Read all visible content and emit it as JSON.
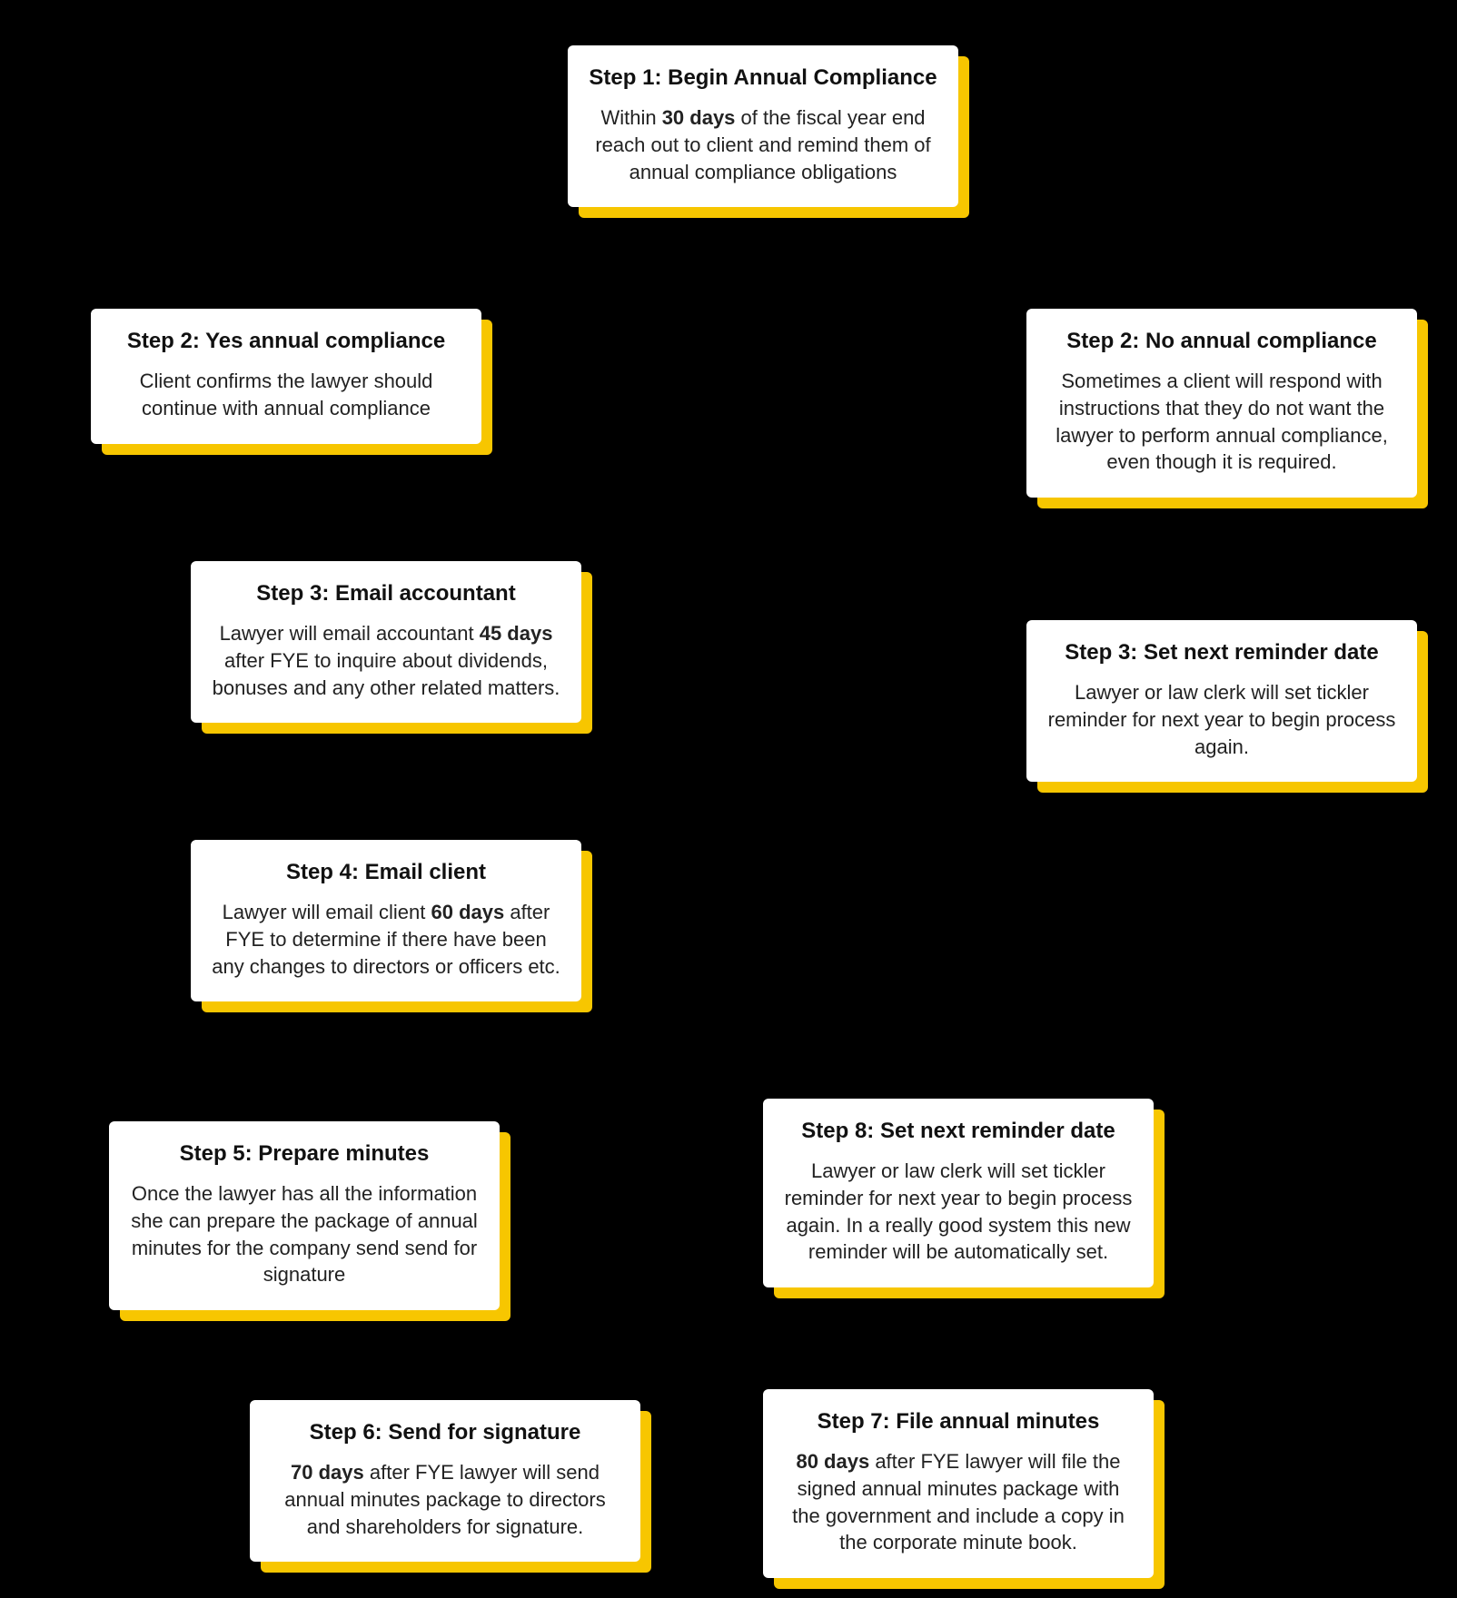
{
  "cards": {
    "step1": {
      "title": "Step 1: Begin Annual Compliance",
      "body": "Within <b>30 days</b> of the fiscal year end reach out to client and remind them of annual compliance obligations"
    },
    "step2yes": {
      "title": "Step 2: Yes annual compliance",
      "body": "Client confirms the lawyer should continue with annual compliance"
    },
    "step2no": {
      "title": "Step 2: No annual compliance",
      "body": "Sometimes a client will respond with instructions that they do not want the lawyer to perform annual compliance, even though it is required."
    },
    "step3email": {
      "title": "Step 3: Email accountant",
      "body": "Lawyer will email accountant <b>45 days</b> after FYE to inquire about dividends, bonuses and any other related matters."
    },
    "step3reminder": {
      "title": "Step 3: Set next reminder date",
      "body": "Lawyer or law clerk will set tickler reminder for next year to begin process again."
    },
    "step4": {
      "title": "Step 4: Email client",
      "body": "Lawyer will email client <b>60 days</b> after FYE to determine if there have been any changes to directors or officers etc."
    },
    "step5": {
      "title": "Step 5: Prepare minutes",
      "body": "Once the lawyer has all the information she can prepare the package of annual minutes for the company send send for signature"
    },
    "step6": {
      "title": "Step 6: Send for signature",
      "body": "<b>70 days</b> after FYE lawyer will send annual minutes package to directors and shareholders for signature."
    },
    "step7": {
      "title": "Step 7: File annual minutes",
      "body": "<b>80 days</b> after FYE lawyer will file the signed annual minutes package with the government and include a copy in the corporate minute book."
    },
    "step8": {
      "title": "Step 8: Set next reminder date",
      "body": "Lawyer or law clerk will set tickler reminder for next year to begin process again. In a really good system this new reminder will be automatically set."
    }
  }
}
